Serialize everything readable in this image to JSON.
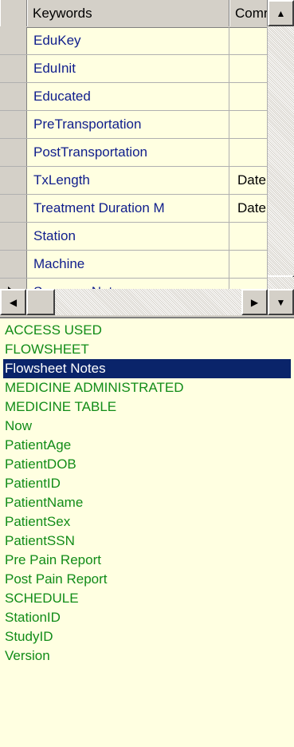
{
  "grid": {
    "columns": [
      "Keywords",
      "Comr"
    ],
    "rows": [
      {
        "keyword": "EduKey",
        "comment": ""
      },
      {
        "keyword": "EduInit",
        "comment": ""
      },
      {
        "keyword": "Educated",
        "comment": ""
      },
      {
        "keyword": "PreTransportation",
        "comment": ""
      },
      {
        "keyword": "PostTransportation",
        "comment": ""
      },
      {
        "keyword": "TxLength",
        "comment": "Date"
      },
      {
        "keyword": "Treatment Duration M",
        "comment": "Date"
      },
      {
        "keyword": "Station",
        "comment": ""
      },
      {
        "keyword": "Machine",
        "comment": ""
      },
      {
        "keyword": "SummaryNotes",
        "comment": ""
      }
    ],
    "current_row_index": 9
  },
  "keyword_list": {
    "items": [
      "ACCESS USED",
      "FLOWSHEET",
      "Flowsheet Notes",
      "MEDICINE ADMINISTRATED",
      "MEDICINE TABLE",
      "Now",
      "PatientAge",
      "PatientDOB",
      "PatientID",
      "PatientName",
      "PatientSex",
      "PatientSSN",
      "Pre Pain Report",
      "Post Pain Report",
      "SCHEDULE",
      "StationID",
      "StudyID",
      "Version"
    ],
    "selected_index": 2
  },
  "colors": {
    "grid_background": "#ffffe1",
    "grid_text": "#0f1d8c",
    "list_text": "#118c18",
    "selection_background": "#0a246a"
  }
}
